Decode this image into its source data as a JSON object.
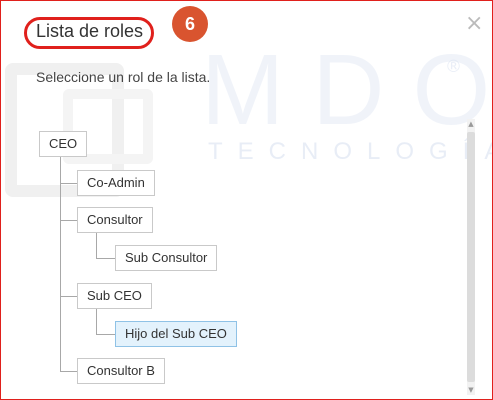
{
  "dialog": {
    "title": "Lista de roles",
    "badge_number": "6",
    "close_symbol": "×",
    "subtitle": "Seleccione un rol de la lista."
  },
  "watermark": {
    "brand": "MDO",
    "tagline": "TECNOLOGÍA",
    "registered": "®"
  },
  "tree": {
    "root": "CEO",
    "nodes": {
      "coadmin": "Co-Admin",
      "consultor": "Consultor",
      "sub_consultor": "Sub Consultor",
      "sub_ceo": "Sub CEO",
      "hijo_sub_ceo": "Hijo del Sub CEO",
      "consultor_b": "Consultor B"
    },
    "selected": "Hijo del Sub CEO"
  },
  "colors": {
    "highlight_red": "#e0201c",
    "badge": "#d9542f",
    "selected_bg": "#e3f2fc"
  },
  "icons": [
    "close-icon",
    "scroll-up-arrow-icon",
    "scroll-down-arrow-icon"
  ]
}
